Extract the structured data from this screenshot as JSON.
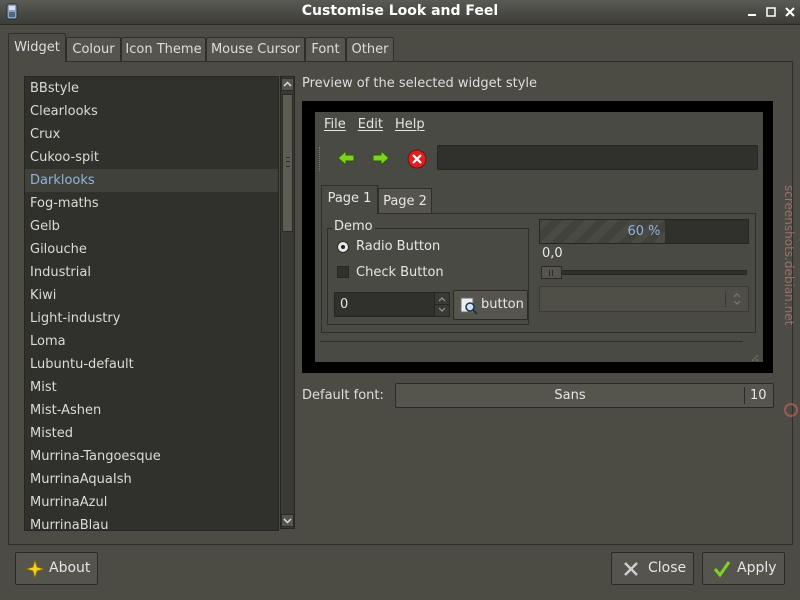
{
  "window": {
    "title": "Customise Look and Feel"
  },
  "tabs": [
    "Widget",
    "Colour",
    "Icon Theme",
    "Mouse Cursor",
    "Font",
    "Other"
  ],
  "themes": {
    "items": [
      "BBstyle",
      "Clearlooks",
      "Crux",
      "Cukoo-spit",
      "Darklooks",
      "Fog-maths",
      "Gelb",
      "Gilouche",
      "Industrial",
      "Kiwi",
      "Light-industry",
      "Loma",
      "Lubuntu-default",
      "Mist",
      "Mist-Ashen",
      "Misted",
      "Murrina-Tangoesque",
      "MurrinaAquaIsh",
      "MurrinaAzul",
      "MurrinaBlau"
    ],
    "selected": "Darklooks"
  },
  "preview": {
    "caption": "Preview of the selected widget style",
    "menu": {
      "file": "File",
      "edit": "Edit",
      "help": "Help"
    },
    "toolbar_icons": [
      "back-arrow-icon",
      "forward-arrow-icon",
      "stop-icon"
    ],
    "tabs": {
      "page1": "Page 1",
      "page2": "Page 2"
    },
    "frame_label": "Demo",
    "radio_label": "Radio Button",
    "check_label": "Check Button",
    "spin_value": "0",
    "button_label": "button",
    "progress": {
      "fraction": 0.6,
      "text": "60 %"
    },
    "scale_value": "0,0"
  },
  "font": {
    "label": "Default font:",
    "name": "Sans",
    "size": "10"
  },
  "footer": {
    "about": "About",
    "close": "Close",
    "apply": "Apply"
  },
  "watermark": {
    "text": "screenshots.debian.net"
  },
  "colors": {
    "accent": "#8fb3dc",
    "background": "#4c4c44",
    "list_bg": "#30302c"
  }
}
